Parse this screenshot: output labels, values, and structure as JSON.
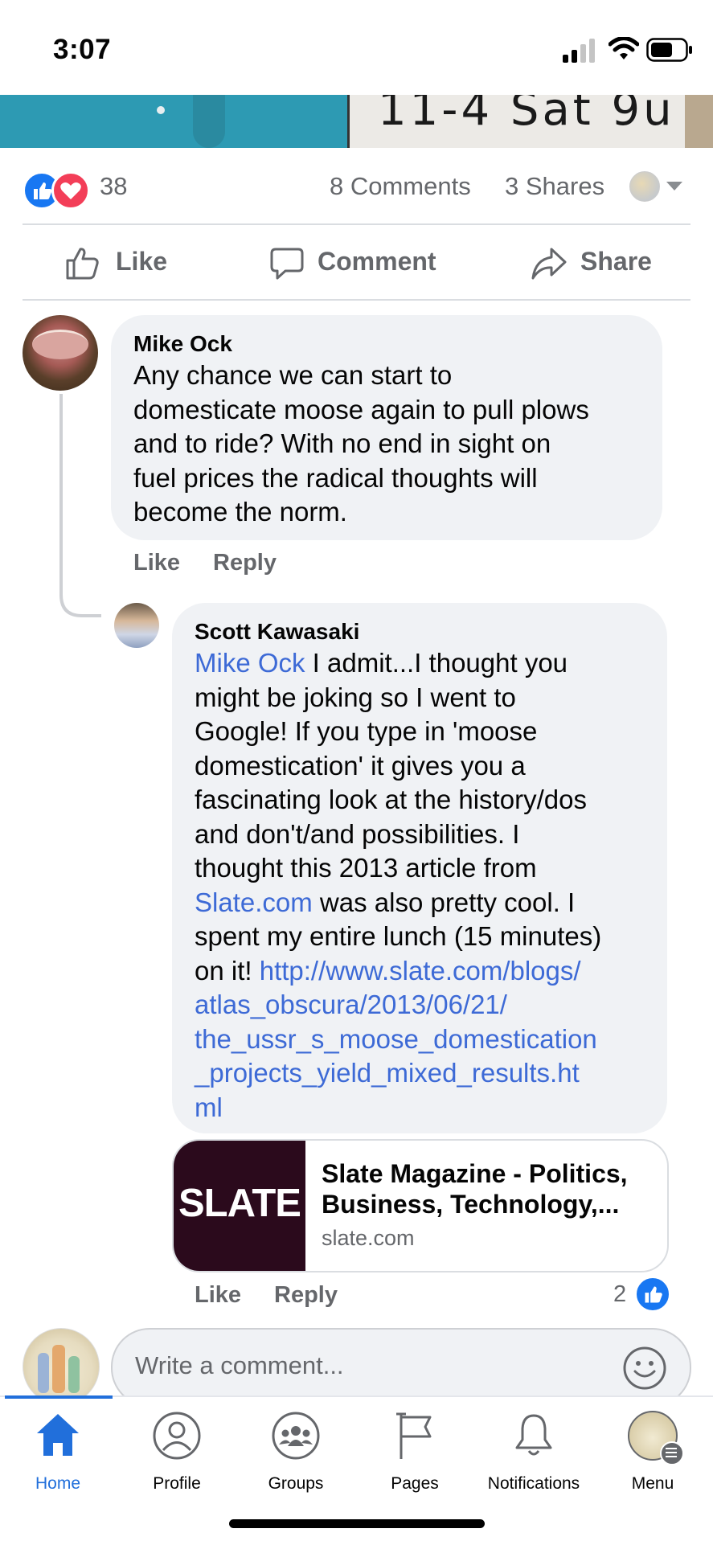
{
  "status_bar": {
    "time": "3:07"
  },
  "post_image": {
    "plate_text": "11-4 Sat 9u"
  },
  "reactions": {
    "count": "38",
    "comments": "8 Comments",
    "shares": "3 Shares"
  },
  "actions": {
    "like": "Like",
    "comment": "Comment",
    "share": "Share"
  },
  "comments": [
    {
      "author": "Mike Ock",
      "lines": [
        "Any chance we can start to",
        "domesticate moose again to pull plows",
        "and to ride?  With no end in sight on",
        "fuel prices the radical thoughts will",
        "become the norm."
      ],
      "like": "Like",
      "reply": "Reply"
    },
    {
      "author": "Scott Kawasaki",
      "mention": "Mike Ock",
      "line1_rest": " I admit...I thought you",
      "lines": [
        "might be joking so I went to",
        "Google! If you type in 'moose",
        "domestication' it gives you a",
        "fascinating look at the history/dos",
        "and don't/and possibilities. I",
        "thought this 2013 article from"
      ],
      "slate_link": "Slate.com",
      "slate_rest": " was also pretty cool. I",
      "line_lunch": "spent my entire lunch (15 minutes)",
      "on_it": "on it! ",
      "url_lines": [
        "http://www.slate.com/blogs/",
        "atlas_obscura/2013/06/21/",
        "the_ussr_s_moose_domestication",
        "_projects_yield_mixed_results.ht",
        "ml"
      ],
      "preview": {
        "logo": "SLATE",
        "title_line1": "Slate Magazine - Politics,",
        "title_line2": "Business, Technology,...",
        "domain": "slate.com"
      },
      "like": "Like",
      "reply": "Reply",
      "like_count": "2"
    }
  ],
  "composer": {
    "placeholder": "Write a comment..."
  },
  "nav": {
    "active_color": "#216fdb",
    "items": [
      {
        "label": "Home",
        "icon": "home-icon"
      },
      {
        "label": "Profile",
        "icon": "profile-icon"
      },
      {
        "label": "Groups",
        "icon": "groups-icon"
      },
      {
        "label": "Pages",
        "icon": "flag-icon"
      },
      {
        "label": "Notifications",
        "icon": "bell-icon"
      },
      {
        "label": "Menu",
        "icon": "menu-avatar-icon"
      }
    ]
  }
}
